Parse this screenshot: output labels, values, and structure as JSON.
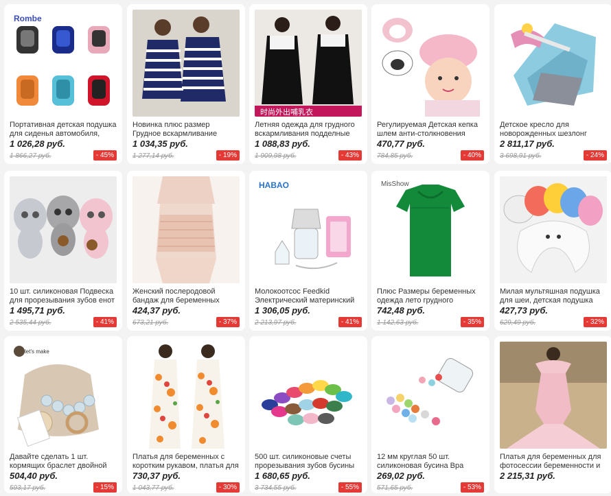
{
  "products": [
    {
      "title": "Портативная детская подушка для сиденья автомобиля,",
      "price": "1 026,28 руб.",
      "old": "1 866,27 руб.",
      "discount": "- 45%",
      "brand": "Rombe"
    },
    {
      "title": "Новинка плюс размер Грудное вскармливание синий",
      "price": "1 034,35 руб.",
      "old": "1 277,14 руб.",
      "discount": "- 19%"
    },
    {
      "title": "Летняя одежда для грудного вскармливания подделные",
      "price": "1 088,83 руб.",
      "old": "1 909,98 руб.",
      "discount": "- 43%",
      "photo_caption": "时尚外出哺乳衣"
    },
    {
      "title": "Регулируемая Детская кепка шлем анти-столкновения",
      "price": "470,77 руб.",
      "old": "784,85 руб.",
      "discount": "- 40%"
    },
    {
      "title": "Детское кресло для новорожденных шезлонг",
      "price": "2 811,17 руб.",
      "old": "3 698,91 руб.",
      "discount": "- 24%"
    },
    {
      "title": "10 шт. силиконовая Подвеска для прорезывания зубов енот",
      "price": "1 495,71 руб.",
      "old": "2 535,44 руб.",
      "discount": "- 41%"
    },
    {
      "title": "Женский послеродовой бандаж для беременных эластичный",
      "price": "424,37 руб.",
      "old": "673,21 руб.",
      "discount": "- 37%"
    },
    {
      "title": "Молокоотсос Feedkid Электрический материнский",
      "price": "1 306,05 руб.",
      "old": "2 213,97 руб.",
      "discount": "- 41%",
      "brand": "HABAO"
    },
    {
      "title": "Плюс Размеры беременных одежда лето грудного",
      "price": "742,48 руб.",
      "old": "1 142,63 руб.",
      "discount": "- 35%",
      "brand": "MisShow"
    },
    {
      "title": "Милая мультяшная подушка для шеи, детская подушка для",
      "price": "427,73 руб.",
      "old": "629,49 руб.",
      "discount": "- 32%"
    },
    {
      "title": "Давайте сделать 1 шт. кормящих браслет двойной",
      "price": "504,40 руб.",
      "old": "593,17 руб.",
      "discount": "- 15%",
      "brand": "let's make"
    },
    {
      "title": "Платья для беременных с коротким рукавом, платья для",
      "price": "730,37 руб.",
      "old": "1 043,77 руб.",
      "discount": "- 30%"
    },
    {
      "title": "500 шт. силиконовые счеты прорезывания зубов бусины",
      "price": "1 680,65 руб.",
      "old": "3 734,55 руб.",
      "discount": "- 55%"
    },
    {
      "title": "12 мм круглая 50 шт. силиконовая бусина Вра",
      "price": "269,02 руб.",
      "old": "571,65 руб.",
      "discount": "- 53%"
    },
    {
      "title": "Платья для беременных для фотосессии беременности и",
      "price": "2 215,31 руб.",
      "old": "",
      "discount": ""
    }
  ],
  "colors": {
    "discount": "#e53935",
    "price": "#222222",
    "old": "#999999"
  }
}
